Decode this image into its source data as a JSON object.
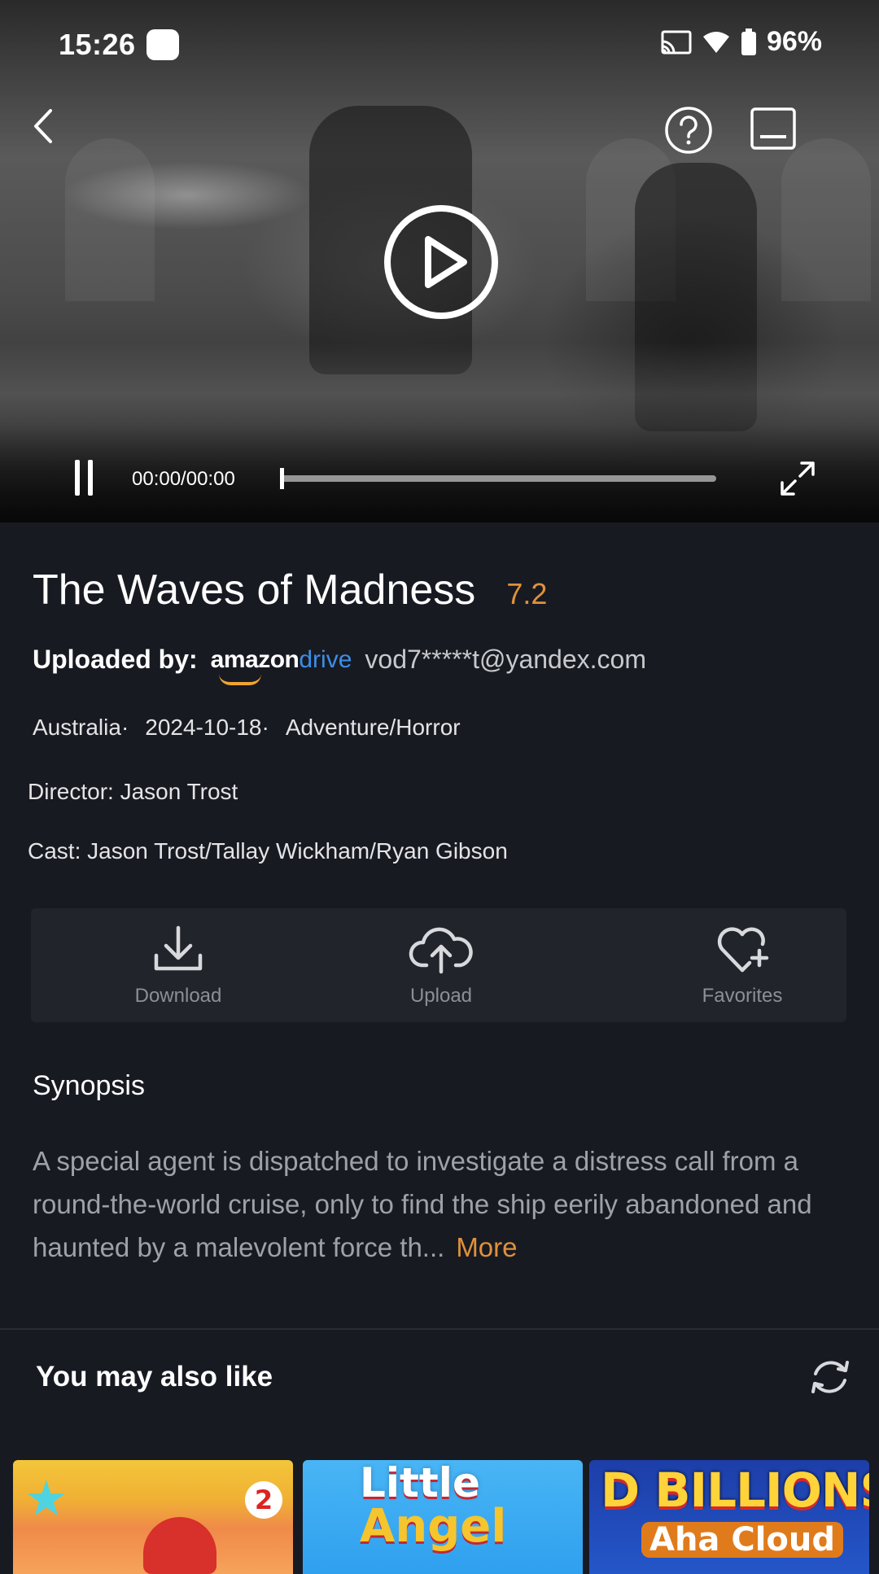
{
  "status_bar": {
    "time": "15:26",
    "battery": "96%",
    "icons": [
      "cast-icon",
      "wifi-icon",
      "battery-icon"
    ]
  },
  "player": {
    "time_display": "00:00/00:00",
    "progress": 0,
    "icons": {
      "back": "back-arrow-icon",
      "help": "help-icon",
      "subtitles": "subtitles-icon",
      "play": "play-icon",
      "pause": "pause-icon",
      "fullscreen": "fullscreen-icon"
    }
  },
  "movie": {
    "title": "The Waves of Madness",
    "rating": "7.2",
    "uploaded_by_label": "Uploaded by:",
    "uploader_brand_amazon": "amazon",
    "uploader_brand_drive": "drive",
    "uploader_email": "vod7*****t@yandex.com",
    "country": "Australia·",
    "date": "2024-10-18·",
    "genre": "Adventure/Horror",
    "director": "Director: Jason Trost",
    "cast": "Cast: Jason Trost/Tallay Wickham/Ryan Gibson"
  },
  "actions": {
    "download": "Download",
    "upload": "Upload",
    "favorites": "Favorites"
  },
  "synopsis": {
    "title": "Synopsis",
    "text": "A special agent is dispatched to investigate a distress call from a round-the-world cruise, only to find the ship eerily abandoned and haunted by a malevolent force th...",
    "more": "More"
  },
  "recommendations": {
    "title": "You may also like",
    "items": [
      {
        "badge": "2"
      },
      {
        "line1": "Little",
        "line2": "Angel"
      },
      {
        "line1": "D BILLIONS",
        "line2": "Aha Cloud"
      }
    ]
  },
  "colors": {
    "background": "#181a22",
    "accent_orange": "#e0913a",
    "drive_blue": "#3c8ee6"
  }
}
